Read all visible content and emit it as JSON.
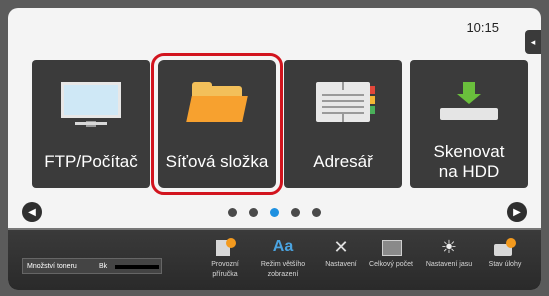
{
  "status": {
    "time": "10:15"
  },
  "tiles": [
    {
      "label": "FTP/Počítač",
      "icon": "monitor-icon"
    },
    {
      "label": "Síťová složka",
      "icon": "folder-icon"
    },
    {
      "label": "Adresář",
      "icon": "address-book-icon"
    },
    {
      "label": "Skenovat\nna HDD",
      "icon": "scan-to-hdd-icon"
    }
  ],
  "pager": {
    "pages": 5,
    "current": 3
  },
  "footer": {
    "toner_label": "Množství toneru",
    "toner_color": "Bk",
    "buttons": [
      {
        "label": "Provozní příručka",
        "icon": "manual-icon"
      },
      {
        "label": "Režim většího zobrazení",
        "icon": "large-text-icon"
      },
      {
        "label": "Nastavení",
        "icon": "settings-tools-icon"
      },
      {
        "label": "Celkový počet",
        "icon": "counter-icon"
      },
      {
        "label": "Nastavení jasu",
        "icon": "brightness-icon"
      },
      {
        "label": "Stav úlohy",
        "icon": "job-status-icon"
      }
    ]
  },
  "colors": {
    "selection": "#d2141e",
    "active_dot": "#1e90e0",
    "tile_bg": "#3b3b3b"
  }
}
